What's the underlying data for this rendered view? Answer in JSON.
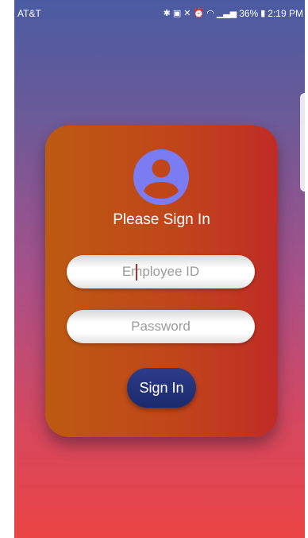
{
  "status_bar": {
    "carrier": "AT&T",
    "battery": "36%",
    "time": "2:19 PM",
    "icons": [
      "bluetooth-icon",
      "nfc-icon",
      "mute-icon",
      "alarm-icon",
      "wifi-icon",
      "signal-icon",
      "battery-icon"
    ]
  },
  "login": {
    "title": "Please Sign In",
    "employee_placeholder": "Employee ID",
    "password_placeholder": "Password",
    "signin_label": "Sign In",
    "avatar_icon": "account-circle-icon"
  },
  "colors": {
    "background_top": "#4a5ba2",
    "background_bottom": "#ea4343",
    "card_left": "#bd5a12",
    "card_right": "#bf2b26",
    "avatar": "#7b7cf2",
    "button": "#23337a"
  }
}
